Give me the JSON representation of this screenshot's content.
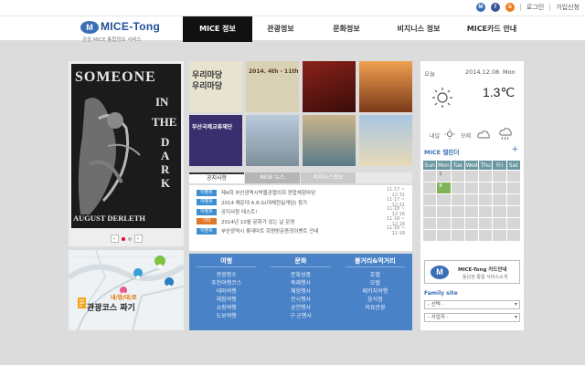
{
  "topbar": {
    "social": [
      {
        "name": "mice-icon",
        "glyph": "M",
        "color": "#3a6fb5"
      },
      {
        "name": "facebook-icon",
        "glyph": "f",
        "color": "#3b5998"
      },
      {
        "name": "blog-icon",
        "glyph": "b",
        "color": "#f07c1b"
      }
    ],
    "login": "로그인",
    "signup": "가입신청"
  },
  "logo": {
    "mark": "M",
    "name": "MICE-Tong",
    "sub": "관광 MICE 통합정보 서비스"
  },
  "nav": [
    {
      "label": "MICE 정보",
      "active": true
    },
    {
      "label": "관광정보",
      "active": false
    },
    {
      "label": "문화정보",
      "active": false
    },
    {
      "label": "비지니스 정보",
      "active": false
    },
    {
      "label": "MICE카드 안내",
      "active": false
    }
  ],
  "poster": {
    "words": [
      "SOMEONE",
      "IN",
      "THE",
      "DARK"
    ],
    "author": "AUGUST DERLETH",
    "prev": "‹",
    "next": "›"
  },
  "course": {
    "tag": "내/맘/대/로",
    "label": "관광코스 짜기"
  },
  "thumbnails": [
    {
      "name": "thumb-culture-event",
      "texts": [
        "우리마당",
        "우리마당"
      ],
      "bg": "#e8e2d0",
      "fg": "#333"
    },
    {
      "name": "thumb-calligraphy-exhibit",
      "texts": [
        "2014. 4th - 11th"
      ],
      "bg": "#d9d1b4",
      "fg": "#5a3a1a"
    },
    {
      "name": "thumb-red-poster",
      "texts": [],
      "bg": "#7a1a14",
      "fg": "#fff"
    },
    {
      "name": "thumb-sunset",
      "texts": [],
      "bg": "#c86a2a",
      "fg": "#fff"
    },
    {
      "name": "thumb-program-flyer",
      "texts": [
        "부산국제교류재단"
      ],
      "bg": "#3a2f6e",
      "fg": "#fff"
    },
    {
      "name": "thumb-tower-monument",
      "texts": [],
      "bg": "#9fb4c6",
      "fg": "#fff"
    },
    {
      "name": "thumb-coast-city",
      "texts": [],
      "bg": "#b7a37a",
      "fg": "#fff"
    },
    {
      "name": "thumb-beach-view",
      "texts": [],
      "bg": "#8fb1cf",
      "fg": "#fff"
    }
  ],
  "tabs": [
    {
      "label": "공지사항",
      "active": true
    },
    {
      "label": "NEW 뉴스",
      "active": false
    },
    {
      "label": "비지니스정보",
      "active": false
    }
  ],
  "notices": [
    {
      "badge": "이벤트",
      "color": "#3d8fd1",
      "title": "제4회 부산광역시박물관협의회 연합체험마당",
      "date": "11·17 ~ 12·31"
    },
    {
      "badge": "이벤트",
      "color": "#3d8fd1",
      "title": "2014 해운대 A.R.G(대체현실게임) 참가",
      "date": "11·17 ~ 12·31"
    },
    {
      "badge": "이벤트",
      "color": "#3d8fd1",
      "title": "공지사항 테스트!",
      "date": "11·18 ~ 12·18"
    },
    {
      "badge": "기타",
      "color": "#e0782a",
      "title": "2014년 10월 문화가 있는 날 운영",
      "date": "11·18 ~ 12·18"
    },
    {
      "badge": "이벤트",
      "color": "#3d8fd1",
      "title": "부산광역시 롯데마트 회원방문증정이벤트 안내",
      "date": "11·18 ~ 12·18"
    }
  ],
  "categories": [
    {
      "head": "여행",
      "links": [
        "관광명소",
        "추천여행코스",
        "테마여행",
        "체험여행",
        "쇼핑여행",
        "도보여행"
      ]
    },
    {
      "head": "문화",
      "links": [
        "문화성품",
        "축제행사",
        "체험행사",
        "전시행사",
        "공연행사",
        "구·군행사"
      ]
    },
    {
      "head": "볼거리&먹거리",
      "links": [
        "호텔",
        "모텔",
        "패키지여행",
        "음식점",
        "의료관광"
      ]
    }
  ],
  "weather": {
    "today_label": "오늘",
    "date": "2014.12.08",
    "day": "Mon",
    "temp": "1.3℃",
    "forecast": [
      {
        "label": "내일",
        "icon": "sun-small-icon"
      },
      {
        "label": "모레",
        "icon": "cloud-icon"
      },
      {
        "label": "",
        "icon": "rain-icon"
      }
    ]
  },
  "calendar": {
    "title": "MICE 캘린더",
    "plus": "+",
    "days": [
      "Sun",
      "Mon",
      "Tue",
      "Wed",
      "Thu",
      "Fri",
      "Sat"
    ],
    "weeks": [
      [
        "",
        "1",
        "",
        "",
        "",
        "",
        ""
      ],
      [
        "",
        "8",
        "",
        "",
        "",
        "",
        ""
      ],
      [
        "",
        "",
        "",
        "",
        "",
        "",
        ""
      ],
      [
        "",
        "",
        "",
        "",
        "",
        "",
        ""
      ],
      [
        "",
        "",
        "",
        "",
        "",
        "",
        ""
      ],
      [
        "",
        "",
        "",
        "",
        "",
        "",
        ""
      ]
    ],
    "today": "8"
  },
  "card": {
    "mark": "M",
    "line1": "MICE-Tong 카드안내",
    "line2": "동남권 통합 서비스소개"
  },
  "family": {
    "title": "Family site",
    "selects": [
      "- 선택 -",
      "- 사업자 -"
    ],
    "caret": "▾"
  }
}
